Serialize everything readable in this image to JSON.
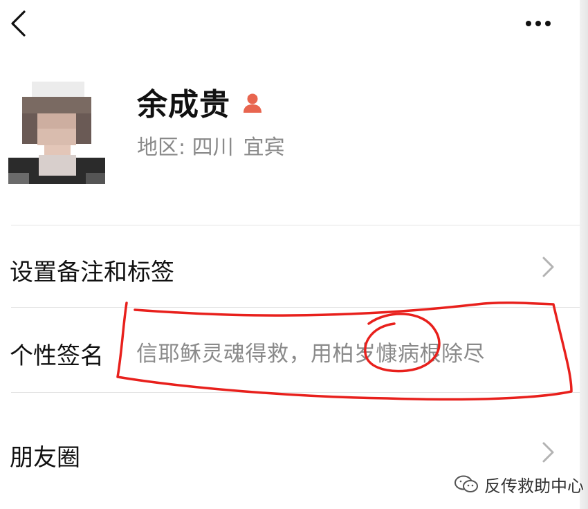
{
  "profile": {
    "name": "余成贵",
    "region": {
      "label": "地区:",
      "province": "四川",
      "city": "宜宾"
    },
    "gender_icon": "female-user-icon",
    "gender_color": "#e8654f"
  },
  "menu": {
    "remarks_tags_label": "设置备注和标签",
    "signature_label": "个性签名",
    "signature_value": "信耶稣灵魂得救，用柏岁慷病根除尽",
    "moments_label": "朋友圈"
  },
  "navigation": {
    "back_icon": "chevron-left-icon",
    "more_icon": "more-dots-icon"
  },
  "annotation": {
    "color": "#e8201c",
    "shape": "hand-drawn-circles"
  },
  "watermark": {
    "text": "反传救助中心",
    "icon": "wechat-icon"
  }
}
